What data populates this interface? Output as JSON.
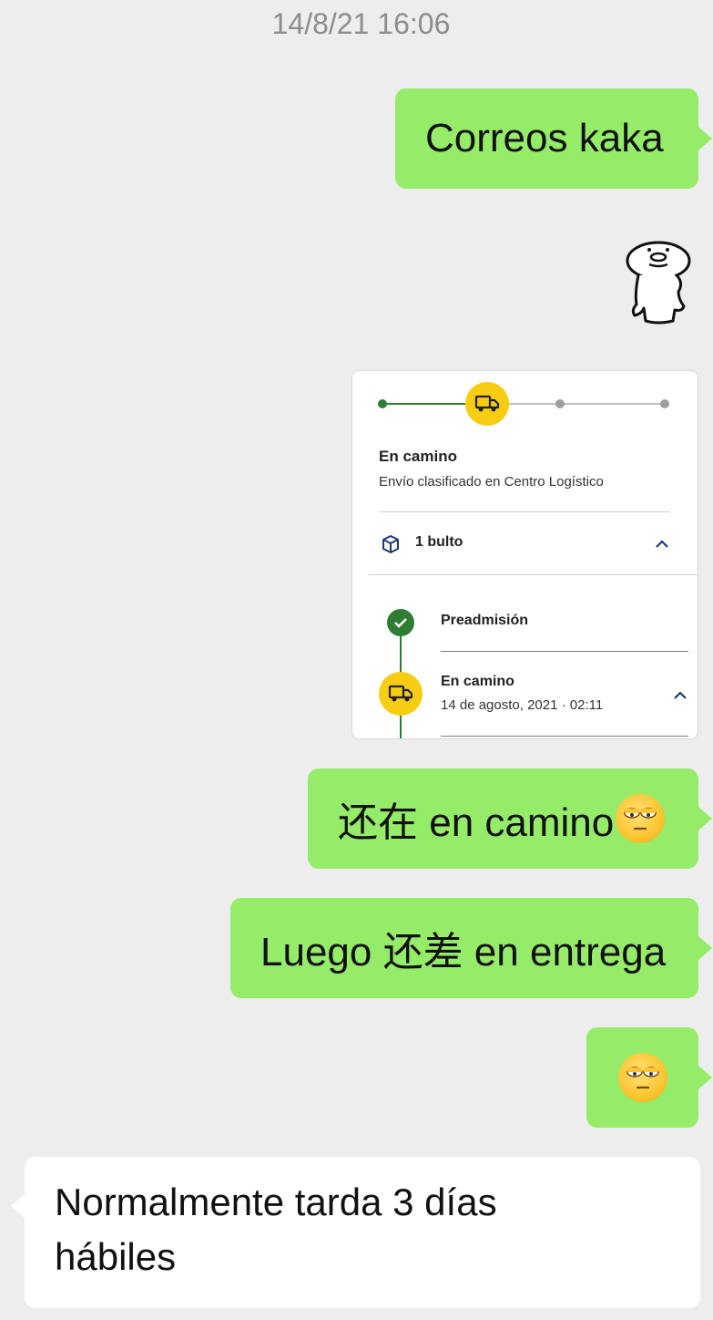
{
  "timestamp": "14/8/21 16:06",
  "messages": {
    "m1": "Correos kaka",
    "m3_prefix": "还在 en camino",
    "m4": "Luego 还差 en entrega",
    "m6": "Normalmente tarda 3 días hábiles"
  },
  "tracking_card": {
    "status_title": "En camino",
    "status_subtitle": "Envío clasificado en Centro Logístico",
    "package_label": "1 bulto",
    "step1_label": "Preadmisión",
    "step2_label": "En camino",
    "step2_date": "14 de agosto, 2021 · 02:11"
  },
  "icons": {
    "sticker": "sticker-character-icon",
    "truck": "truck-icon",
    "package": "package-icon",
    "check": "check-icon",
    "chevron": "chevron-up-icon",
    "emoji": "eye-roll-emoji-icon"
  },
  "colors": {
    "outgoing_bubble": "#95ec69",
    "incoming_bubble": "#ffffff",
    "background": "#ededed",
    "timeline_green": "#2e7d32",
    "truck_yellow": "#f7cd14"
  }
}
